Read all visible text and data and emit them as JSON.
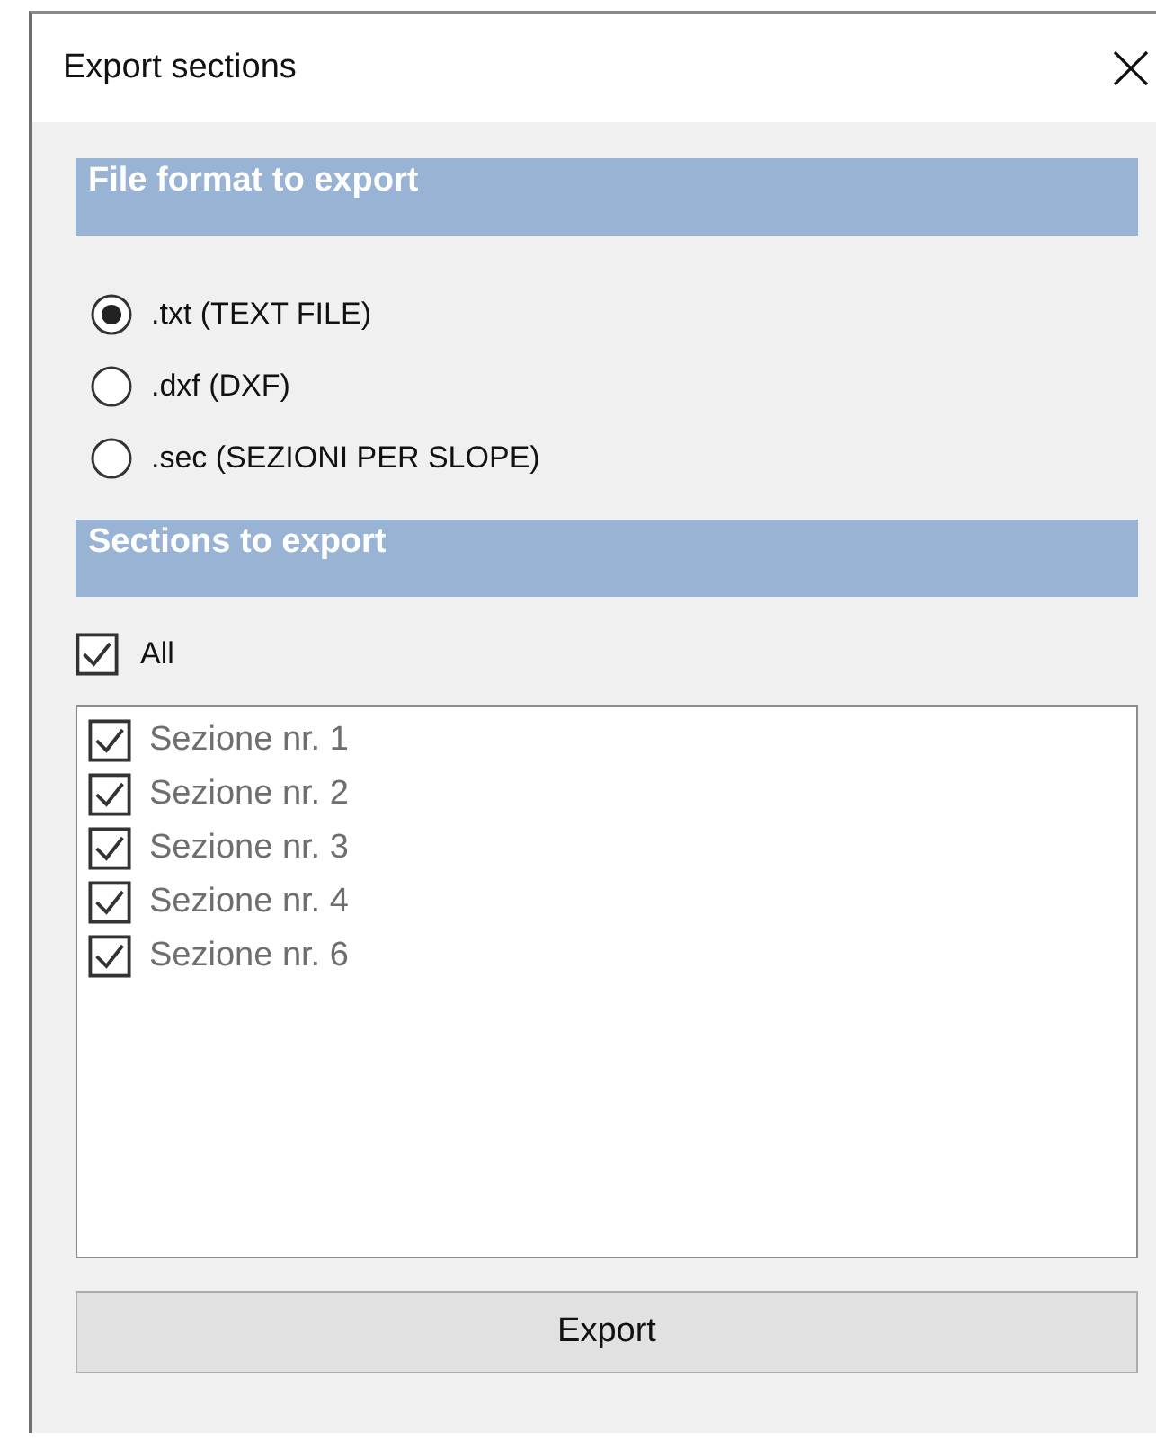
{
  "window": {
    "title": "Export sections"
  },
  "format_header": "File format to export",
  "formats": [
    {
      "label": ".txt (TEXT FILE)",
      "selected": true
    },
    {
      "label": ".dxf (DXF)",
      "selected": false
    },
    {
      "label": ".sec (SEZIONI PER SLOPE)",
      "selected": false
    }
  ],
  "sections_header": "Sections to export",
  "all": {
    "label": "All",
    "checked": true
  },
  "sections": [
    {
      "label": "Sezione nr. 1",
      "checked": true
    },
    {
      "label": "Sezione nr. 2",
      "checked": true
    },
    {
      "label": "Sezione nr. 3",
      "checked": true
    },
    {
      "label": "Sezione nr. 4",
      "checked": true
    },
    {
      "label": "Sezione nr. 6",
      "checked": true
    }
  ],
  "button": "Export"
}
